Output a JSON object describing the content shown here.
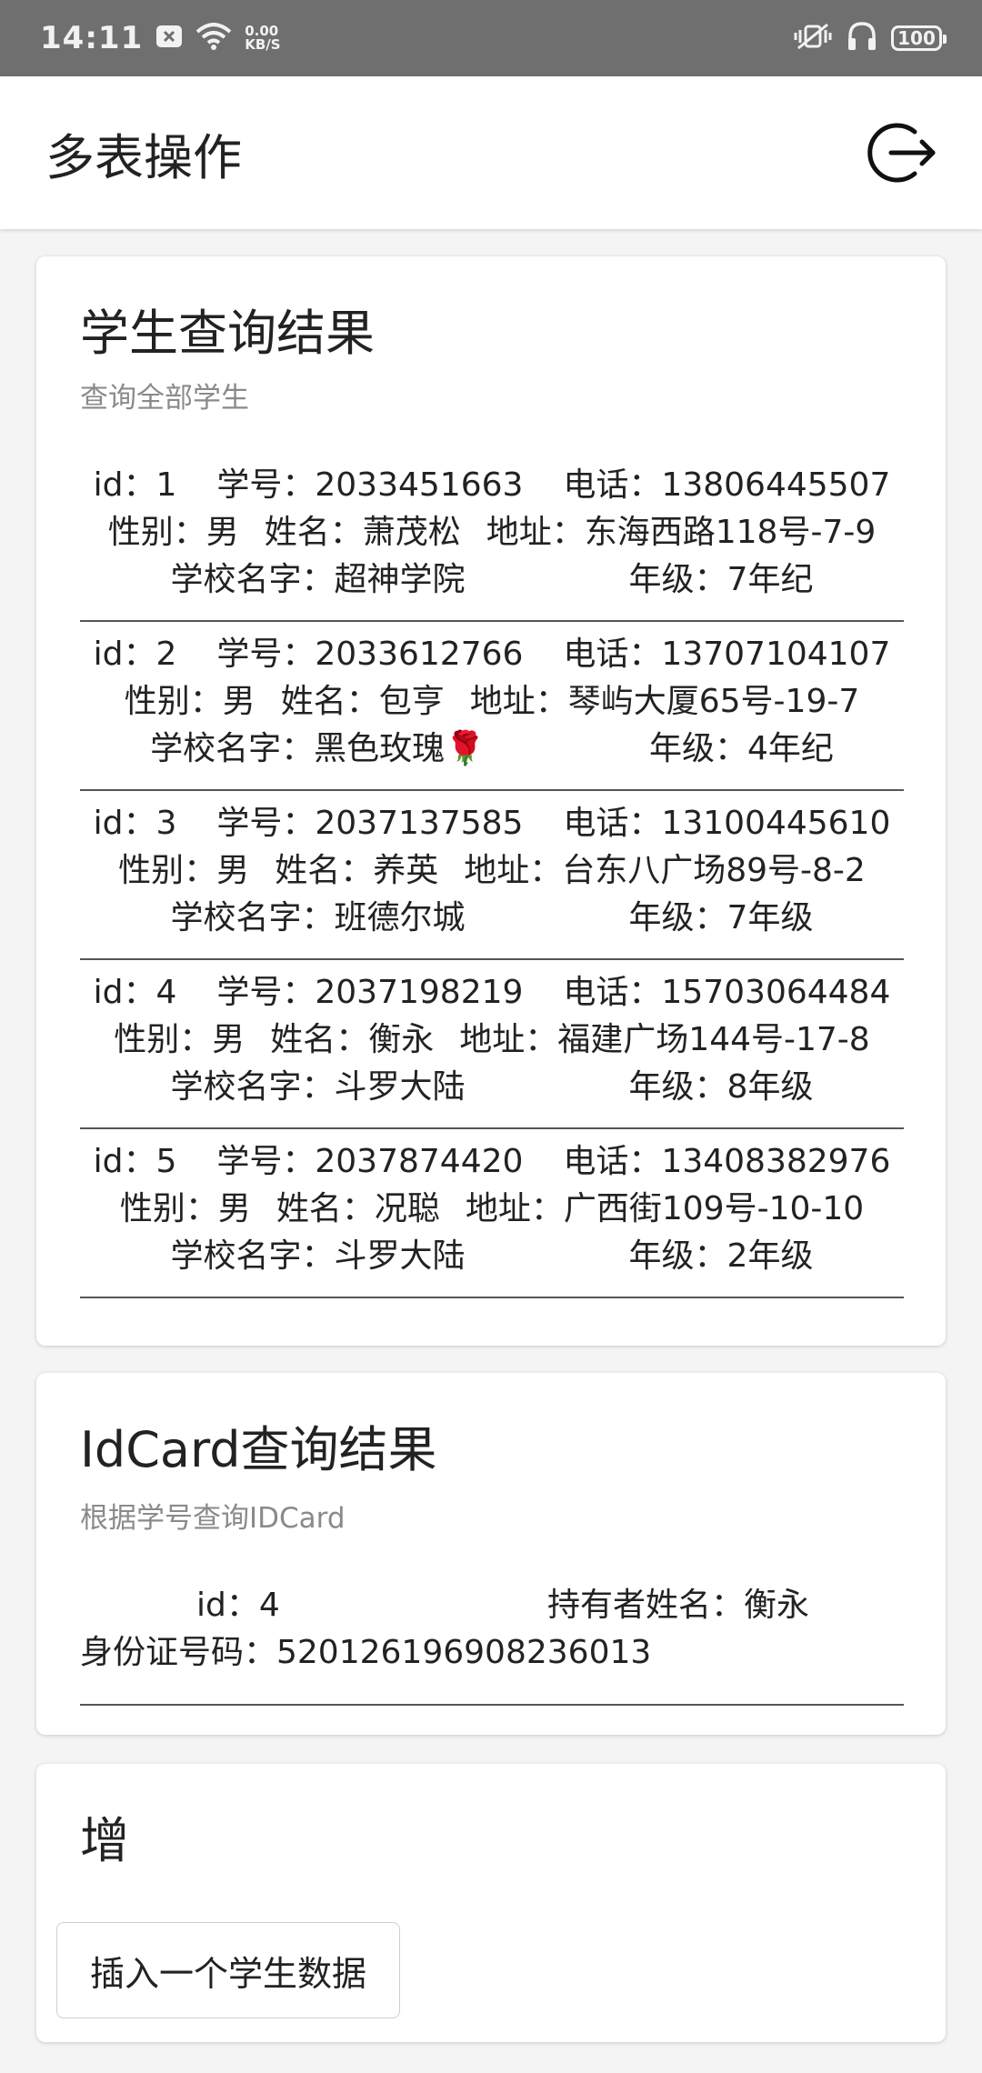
{
  "status_bar": {
    "time": "14:11",
    "speed_value": "0.00",
    "speed_unit": "KB/S",
    "battery": "100",
    "icons": [
      "close-box-icon",
      "wifi-icon",
      "vibrate-icon",
      "headphones-icon",
      "battery-icon"
    ]
  },
  "appbar": {
    "title": "多表操作",
    "action_icon": "logout-icon"
  },
  "students_card": {
    "title": "学生查询结果",
    "subtitle": "查询全部学生",
    "rows": [
      {
        "id": "id：1",
        "no": "学号：2033451663",
        "phone": "电话：13806445507",
        "gender": "性别：男",
        "name": "姓名：萧茂松",
        "address": "地址：东海西路118号-7-9",
        "school": "学校名字：超神学院",
        "grade": "年级：7年纪"
      },
      {
        "id": "id：2",
        "no": "学号：2033612766",
        "phone": "电话：13707104107",
        "gender": "性别：男",
        "name": "姓名：包亨",
        "address": "地址：琴屿大厦65号-19-7",
        "school": "学校名字：黑色玫瑰🌹",
        "grade": "年级：4年纪"
      },
      {
        "id": "id：3",
        "no": "学号：2037137585",
        "phone": "电话：13100445610",
        "gender": "性别：男",
        "name": "姓名：养英",
        "address": "地址：台东八广场89号-8-2",
        "school": "学校名字：班德尔城",
        "grade": "年级：7年级"
      },
      {
        "id": "id：4",
        "no": "学号：2037198219",
        "phone": "电话：15703064484",
        "gender": "性别：男",
        "name": "姓名：衡永",
        "address": "地址：福建广场144号-17-8",
        "school": "学校名字：斗罗大陆",
        "grade": "年级：8年级"
      },
      {
        "id": "id：5",
        "no": "学号：2037874420",
        "phone": "电话：13408382976",
        "gender": "性别：男",
        "name": "姓名：况聪",
        "address": "地址：广西街109号-10-10",
        "school": "学校名字：斗罗大陆",
        "grade": "年级：2年级"
      }
    ]
  },
  "idcard_card": {
    "title": "IdCard查询结果",
    "subtitle": "根据学号查询IDCard",
    "id": "id：4",
    "holder": "持有者姓名：衡永",
    "number": "身份证号码：520126196908236013"
  },
  "insert_card": {
    "title": "增",
    "button_label": "插入一个学生数据"
  }
}
